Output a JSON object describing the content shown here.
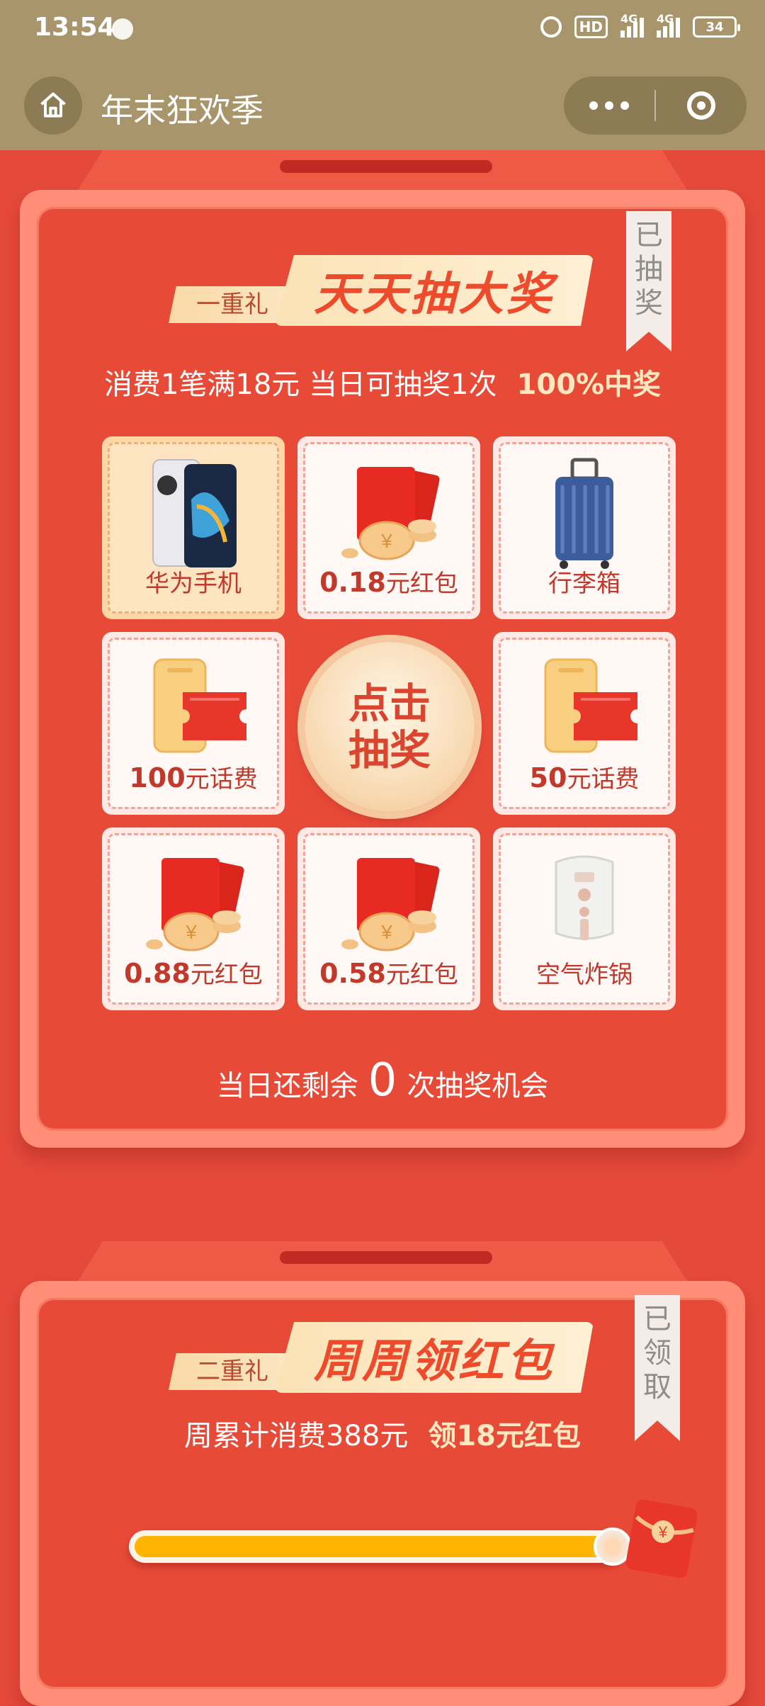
{
  "status_bar": {
    "time": "13:54",
    "hd_label": "HD",
    "network1": "4G",
    "network2": "4G",
    "battery": "34"
  },
  "title_bar": {
    "title": "年末狂欢季",
    "icons": [
      "home-icon",
      "more-icon",
      "close-icon"
    ]
  },
  "section1": {
    "tag": "一重礼",
    "title": "天天抽大奖",
    "ribbon": [
      "已",
      "抽",
      "奖"
    ],
    "rule": "消费1笔满18元 当日可抽奖1次",
    "rule_highlight": "100%中奖",
    "prizes": [
      {
        "label": "华为手机",
        "icon": "phone-icon",
        "active": true
      },
      {
        "num": "0.18",
        "unit": "元红包",
        "icon": "red-packet-coins-icon"
      },
      {
        "label": "行李箱",
        "icon": "suitcase-icon"
      },
      {
        "num": "100",
        "unit": "元话费",
        "icon": "phone-credit-icon"
      },
      {
        "num": "50",
        "unit": "元话费",
        "icon": "phone-credit-icon"
      },
      {
        "num": "0.88",
        "unit": "元红包",
        "icon": "red-packet-coins-icon"
      },
      {
        "num": "0.58",
        "unit": "元红包",
        "icon": "red-packet-coins-icon"
      },
      {
        "label": "空气炸锅",
        "icon": "air-fryer-icon"
      }
    ],
    "draw_button": [
      "点击",
      "抽奖"
    ],
    "remaining_prefix": "当日还剩余",
    "remaining_count": "0",
    "remaining_suffix": "次抽奖机会"
  },
  "section2": {
    "tag": "二重礼",
    "title": "周周领红包",
    "ribbon": [
      "已",
      "领",
      "取"
    ],
    "rule": "周累计消费388元",
    "rule_highlight": "领18元红包",
    "progress_fraction": 1.0
  },
  "colors": {
    "header_bg": "#a8956c",
    "page_bg": "#e4493a",
    "accent_gold": "#ffb400",
    "prize_text": "#c2382a"
  }
}
